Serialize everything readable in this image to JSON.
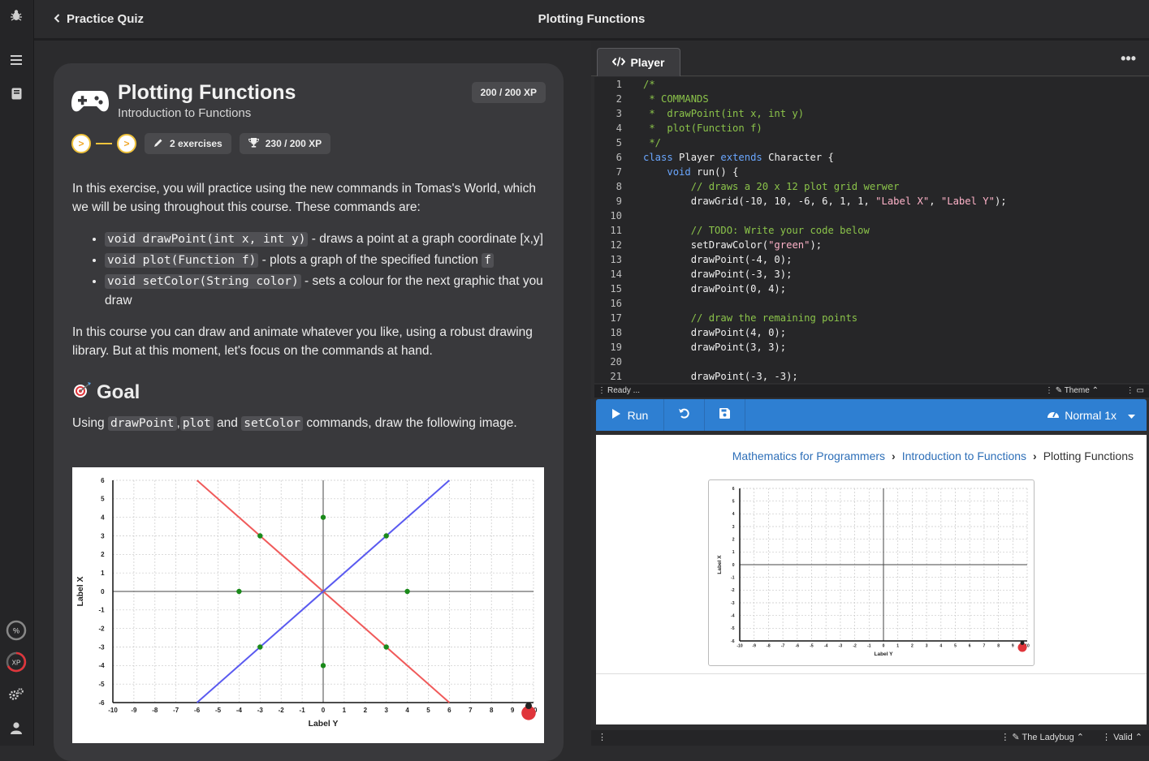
{
  "header": {
    "back_label": "Practice Quiz",
    "title": "Plotting Functions"
  },
  "exercise": {
    "title": "Plotting Functions",
    "subtitle": "Introduction to Functions",
    "xp_badge": "200 / 200 XP",
    "exercises_label": "2 exercises",
    "trophy_label": "230 / 200 XP",
    "steps": [
      ">",
      ">"
    ]
  },
  "content": {
    "intro": "In this exercise, you will practice using the new commands in Tomas's World, which we will be using throughout this course. These commands are:",
    "bullets": [
      {
        "code": "void drawPoint(int x, int y)",
        "text": " - draws a point at a graph coordinate [x,y]"
      },
      {
        "code": "void plot(Function f)",
        "text": " - plots a graph of the specified function ",
        "code2": "f"
      },
      {
        "code": "void setColor(String color)",
        "text": " - sets a colour for the next graphic that you draw"
      }
    ],
    "para2": "In this course you can draw and animate whatever you like, using a robust drawing library. But at this moment, let's focus on the commands at hand.",
    "goal_title": "Goal",
    "goal_pre": "Using ",
    "goal_c1": "drawPoint",
    "goal_sep1": ",",
    "goal_c2": "plot",
    "goal_mid": " and ",
    "goal_c3": "setColor",
    "goal_post": " commands,  draw the following image."
  },
  "chart_data": [
    {
      "type": "scatter",
      "title": "",
      "xlabel": "Label Y",
      "ylabel": "Label X",
      "xlim": [
        -10,
        10
      ],
      "ylim": [
        -6,
        6
      ],
      "grid": true,
      "series": [
        {
          "kind": "line",
          "color": "#f05a5a",
          "points": [
            [
              -6,
              6
            ],
            [
              6,
              -6
            ]
          ]
        },
        {
          "kind": "line",
          "color": "#5a5af0",
          "points": [
            [
              -6,
              -6
            ],
            [
              6,
              6
            ]
          ]
        },
        {
          "kind": "points",
          "color": "#1a8a1a",
          "points": [
            [
              -4,
              0
            ],
            [
              4,
              0
            ],
            [
              0,
              4
            ],
            [
              0,
              -4
            ],
            [
              -3,
              3
            ],
            [
              3,
              -3
            ],
            [
              -3,
              -3
            ],
            [
              3,
              3
            ]
          ]
        }
      ]
    },
    {
      "type": "scatter",
      "title": "",
      "xlabel": "Label Y",
      "ylabel": "Label X",
      "xlim": [
        -10,
        10
      ],
      "ylim": [
        -6,
        6
      ],
      "grid": true,
      "series": []
    }
  ],
  "editor": {
    "tab_label": "Player",
    "status_left": "Ready ...",
    "status_theme": "Theme",
    "lines": [
      {
        "n": "1",
        "t": "/*",
        "c": "cm"
      },
      {
        "n": "2",
        "t": " * COMMANDS",
        "c": "cm"
      },
      {
        "n": "3",
        "t": " *  drawPoint(int x, int y)",
        "c": "cm"
      },
      {
        "n": "4",
        "t": " *  plot(Function f)",
        "c": "cm"
      },
      {
        "n": "5",
        "t": " */",
        "c": "cm"
      },
      {
        "n": "6",
        "t": "",
        "c": "nm",
        "parts": [
          [
            "kw",
            "class "
          ],
          [
            "nm",
            "Player "
          ],
          [
            "kw",
            "extends "
          ],
          [
            "nm",
            "Character {"
          ]
        ]
      },
      {
        "n": "7",
        "t": "",
        "c": "nm",
        "parts": [
          [
            "nm",
            "    "
          ],
          [
            "kw",
            "void "
          ],
          [
            "nm",
            "run() {"
          ]
        ]
      },
      {
        "n": "8",
        "t": "        // draws a 20 x 12 plot grid werwer",
        "c": "cm"
      },
      {
        "n": "9",
        "t": "",
        "c": "nm",
        "parts": [
          [
            "nm",
            "        drawGrid(-10, 10, -6, 6, 1, 1, "
          ],
          [
            "st",
            "\"Label X\""
          ],
          [
            "nm",
            ", "
          ],
          [
            "st",
            "\"Label Y\""
          ],
          [
            "nm",
            ");"
          ]
        ]
      },
      {
        "n": "10",
        "t": "",
        "c": "nm"
      },
      {
        "n": "11",
        "t": "        // TODO: Write your code below",
        "c": "cm"
      },
      {
        "n": "12",
        "t": "",
        "c": "nm",
        "parts": [
          [
            "nm",
            "        setDrawColor("
          ],
          [
            "st",
            "\"green\""
          ],
          [
            "nm",
            ");"
          ]
        ]
      },
      {
        "n": "13",
        "t": "        drawPoint(-4, 0);",
        "c": "nm"
      },
      {
        "n": "14",
        "t": "        drawPoint(-3, 3);",
        "c": "nm"
      },
      {
        "n": "15",
        "t": "        drawPoint(0, 4);",
        "c": "nm"
      },
      {
        "n": "16",
        "t": "",
        "c": "nm"
      },
      {
        "n": "17",
        "t": "        // draw the remaining points",
        "c": "cm"
      },
      {
        "n": "18",
        "t": "        drawPoint(4, 0);",
        "c": "nm"
      },
      {
        "n": "19",
        "t": "        drawPoint(3, 3);",
        "c": "nm"
      },
      {
        "n": "20",
        "t": "",
        "c": "nm"
      },
      {
        "n": "21",
        "t": "        drawPoint(-3, -3);",
        "c": "nm"
      }
    ]
  },
  "runner": {
    "run_label": "Run",
    "speed_label": "Normal 1x"
  },
  "stage": {
    "crumbs": [
      "Mathematics for Programmers",
      "Introduction to Functions",
      "Plotting Functions"
    ]
  },
  "footer": {
    "credit": "The Ladybug",
    "valid": "Valid"
  },
  "rail": {
    "percent_label": "%",
    "xp_label": "XP"
  },
  "colors": {
    "accent": "#2e7fd2",
    "step": "#f0c33c",
    "card": "#39393c"
  }
}
